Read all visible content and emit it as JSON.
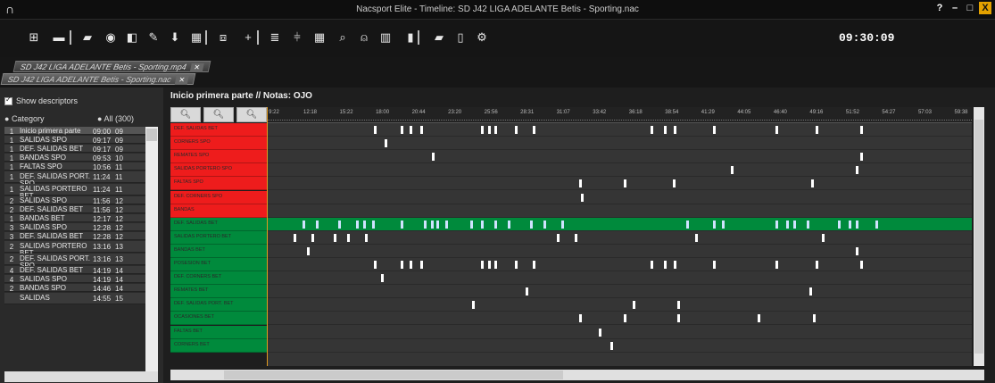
{
  "window": {
    "title": "Nacsport Elite - Timeline: SD J42 LIGA ADELANTE Betis - Sporting.nac",
    "help": "?",
    "minimize": "–",
    "maximize": "□",
    "close": "X"
  },
  "toolbar": {
    "clock": "09:30:09",
    "icons": [
      "grid-icon",
      "monitor-icon",
      "clapper-icon",
      "camera-icon",
      "window-icon",
      "pen-icon",
      "pin-icon",
      "table-icon",
      "frame-icon",
      "plus-icon",
      "list-icon",
      "split-icon",
      "matrix-icon",
      "search-icon",
      "user-search-icon",
      "columns-icon",
      "chart-icon",
      "folder-icon",
      "clipboard-icon",
      "gear-icon"
    ]
  },
  "tabs": [
    {
      "label": "SD J42 LIGA ADELANTE Betis - Sporting.mp4",
      "close": "✕"
    },
    {
      "label": "SD J42 LIGA ADELANTE Betis - Sporting.nac",
      "close": "✕"
    }
  ],
  "left_panel": {
    "show_descriptors": "Show descriptors",
    "category_header": "Category",
    "all_header": "All (300)",
    "rows": [
      {
        "n": "1",
        "name": "Inicio primera parte",
        "t": "09:00",
        "t2": "09"
      },
      {
        "n": "1",
        "name": "SALIDAS SPO",
        "t": "09:17",
        "t2": "09"
      },
      {
        "n": "1",
        "name": "DEF. SALIDAS BET",
        "t": "09:17",
        "t2": "09"
      },
      {
        "n": "1",
        "name": "BANDAS SPO",
        "t": "09:53",
        "t2": "10"
      },
      {
        "n": "1",
        "name": "FALTAS SPO",
        "t": "10:56",
        "t2": "11"
      },
      {
        "n": "1",
        "name": "DEF. SALIDAS PORT. SPO",
        "t": "11:24",
        "t2": "11"
      },
      {
        "n": "1",
        "name": "SALIDAS PORTERO BET",
        "t": "11:24",
        "t2": "11"
      },
      {
        "n": "2",
        "name": "SALIDAS SPO",
        "t": "11:56",
        "t2": "12"
      },
      {
        "n": "2",
        "name": "DEF. SALIDAS BET",
        "t": "11:56",
        "t2": "12"
      },
      {
        "n": "1",
        "name": "BANDAS BET",
        "t": "12:17",
        "t2": "12"
      },
      {
        "n": "3",
        "name": "SALIDAS SPO",
        "t": "12:28",
        "t2": "12"
      },
      {
        "n": "3",
        "name": "DEF. SALIDAS BET",
        "t": "12:28",
        "t2": "12"
      },
      {
        "n": "2",
        "name": "SALIDAS PORTERO BET",
        "t": "13:16",
        "t2": "13"
      },
      {
        "n": "2",
        "name": "DEF. SALIDAS PORT. SPO",
        "t": "13:16",
        "t2": "13"
      },
      {
        "n": "4",
        "name": "DEF. SALIDAS BET",
        "t": "14:19",
        "t2": "14"
      },
      {
        "n": "4",
        "name": "SALIDAS SPO",
        "t": "14:19",
        "t2": "14"
      },
      {
        "n": "2",
        "name": "BANDAS SPO",
        "t": "14:46",
        "t2": "14"
      },
      {
        "n": "",
        "name": "SALIDAS",
        "t": "14:55",
        "t2": "15"
      }
    ]
  },
  "main": {
    "segment_title": "Inicio primera parte // Notas: OJO",
    "zoom_buttons": [
      "zoom-fit",
      "zoom-in",
      "zoom-out"
    ],
    "ruler_ticks": [
      "9:22",
      "12:18",
      "15:22",
      "18:00",
      "20:44",
      "23:20",
      "25:56",
      "28:31",
      "31:07",
      "33:42",
      "36:18",
      "38:54",
      "41:29",
      "44:05",
      "46:40",
      "49:16",
      "51:52",
      "54:27",
      "57:03",
      "59:38"
    ],
    "tracks_red": [
      "DEF. SALIDAS BET",
      "CORNERS SPO",
      "REMATES SPO",
      "SALIDAS PORTERO SPO",
      "FALTAS SPO",
      "DEF. CORNERS SPO",
      "BANDAS"
    ],
    "tracks_green": [
      "DEF. SALIDAS BET",
      "SALIDAS PORTERO BET",
      "BANDAS BET",
      "POSESION BET",
      "DEF. CORNERS BET",
      "REMATES BET",
      "DEF. SALIDAS PORT. BET",
      "OCASIONES BET",
      "FALTAS BET",
      "CORNERS BET"
    ],
    "colors": {
      "red": "#ee1c1c",
      "green": "#008a3c",
      "cursor": "#e09a20"
    }
  }
}
